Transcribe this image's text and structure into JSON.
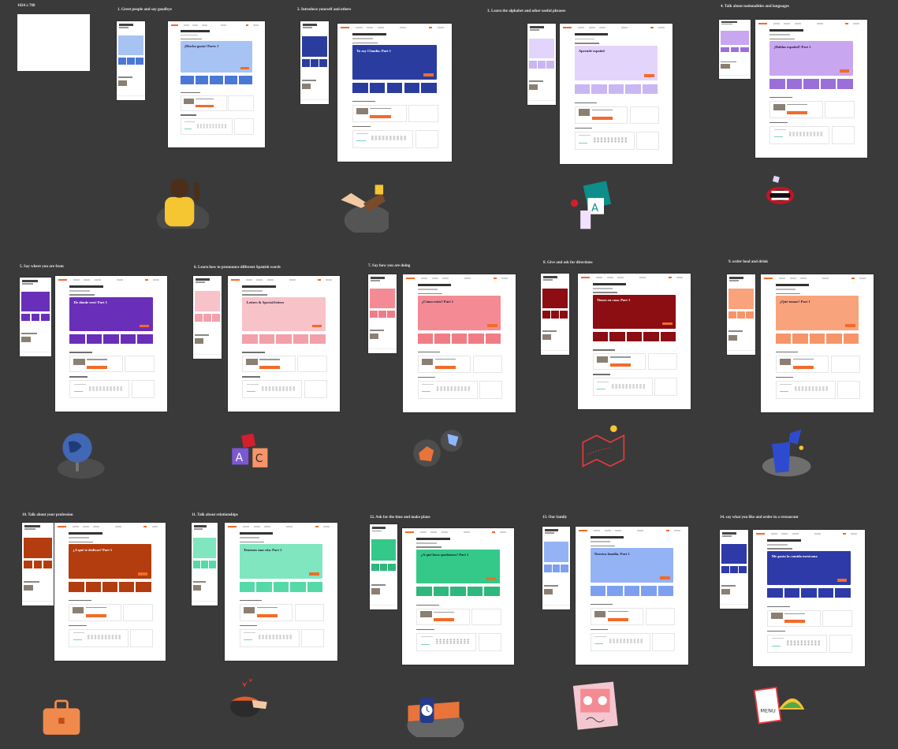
{
  "size_label": "1024 x 768",
  "accent": "#f26b2a",
  "boards": [
    {
      "title": "1.  Greet people and say goodbye",
      "hero_text": "¡Mucho gusto! Parte 1",
      "color": "#a7c3f4",
      "tile": "#4b78d6",
      "illustration": "person-waving"
    },
    {
      "title": "2.  Introduce yourself and others",
      "hero_text": "Yo soy Claudia. Part 1",
      "color": "#2a3d9f",
      "tile": "#2a3d9f",
      "illustration": "handshake"
    },
    {
      "title": "3.  Learn the alphabet and other useful phrases",
      "hero_text": "Aprende español",
      "color": "#e2d4fb",
      "tile": "#c9b6f3",
      "illustration": "alphabet-cards"
    },
    {
      "title": "4.  Talk about nationalities and languages",
      "hero_text": "¡Hablas español? Part 1",
      "color": "#c9a6f0",
      "tile": "#9b6fd8",
      "illustration": "open-mouth"
    },
    {
      "title": "5.  Say where you are from",
      "hero_text": "De dónde eres! Part 1",
      "color": "#6a2fb8",
      "tile": "#6a2fb8",
      "illustration": "globe"
    },
    {
      "title": "6.  Learn how to pronounce different Spanish words",
      "hero_text": "Letters & Special letters",
      "color": "#f8c2c9",
      "tile": "#f3a0ab",
      "illustration": "letter-blocks"
    },
    {
      "title": "7.  Say how you are doing",
      "hero_text": "¿Cómo estás? Part 1",
      "color": "#f48b94",
      "tile": "#f07c86",
      "illustration": "thumbs"
    },
    {
      "title": "8.  Give and ask for directions",
      "hero_text": "Tienes en casa. Part 1",
      "color": "#8c0d12",
      "tile": "#8c0d12",
      "illustration": "map"
    },
    {
      "title": "9.  order food and drink",
      "hero_text": "¿Qué tomas? Part 1",
      "color": "#f9a37c",
      "tile": "#f79569",
      "illustration": "drink-cup"
    },
    {
      "title": "10.  Talk about your profession",
      "hero_text": "¿A qué te dedicas? Part 1",
      "color": "#b33d0e",
      "tile": "#b33d0e",
      "illustration": "briefcase"
    },
    {
      "title": "11.  Talk about relationships",
      "hero_text": "Tenemos una cita. Part 1",
      "color": "#7fe6bf",
      "tile": "#56d9a8",
      "illustration": "hearts-bowl"
    },
    {
      "title": "12.  Ask for the time and make plans",
      "hero_text": "¿A qué hora quedamos? Part 1",
      "color": "#34c989",
      "tile": "#2fb87c",
      "illustration": "wristwatch"
    },
    {
      "title": "13.  Our family",
      "hero_text": "Nuestra familia. Part 1",
      "color": "#93b3f5",
      "tile": "#7d9ff0",
      "illustration": "family-photo"
    },
    {
      "title": "14.  say what you like and order in a restaurant",
      "hero_text": "Me gusta la comida mexicana",
      "color": "#2d3aa8",
      "tile": "#2d3aa8",
      "illustration": "menu-taco"
    }
  ]
}
